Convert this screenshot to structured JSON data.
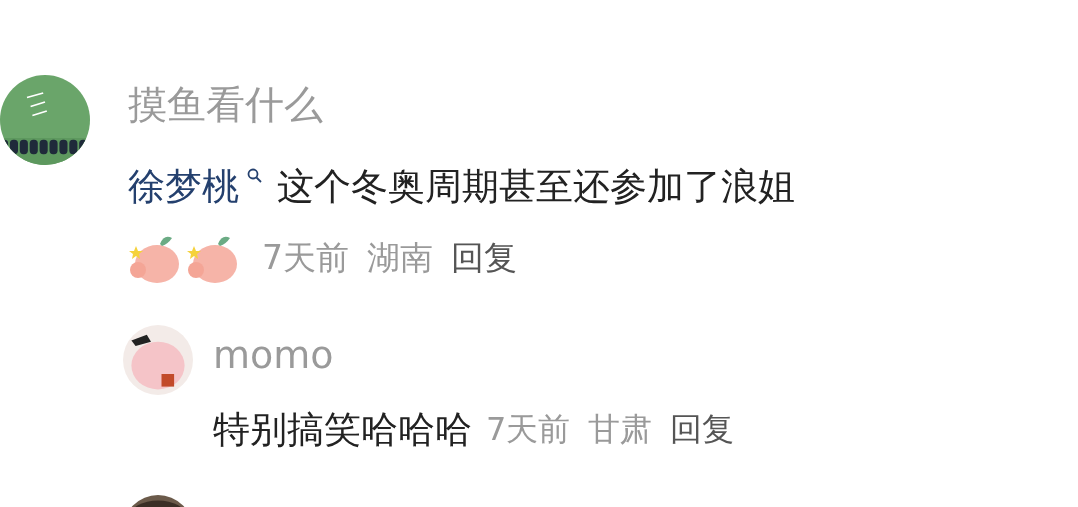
{
  "comment": {
    "avatar": {
      "kind": "picture"
    },
    "username": "摸鱼看什么",
    "mention": "徐梦桃",
    "text": "这个冬奥周期甚至还参加了浪姐",
    "stickers": [
      {
        "kind": "sticker"
      },
      {
        "kind": "sticker"
      }
    ],
    "time": "7天前",
    "location": "湖南",
    "reply_label": "回复",
    "replies": [
      {
        "avatar": {
          "kind": "picture"
        },
        "username": "momo",
        "text": "特别搞笑哈哈哈",
        "time": "7天前",
        "location": "甘肃",
        "reply_label": "回复"
      },
      {
        "avatar": {
          "kind": "picture"
        }
      }
    ]
  }
}
